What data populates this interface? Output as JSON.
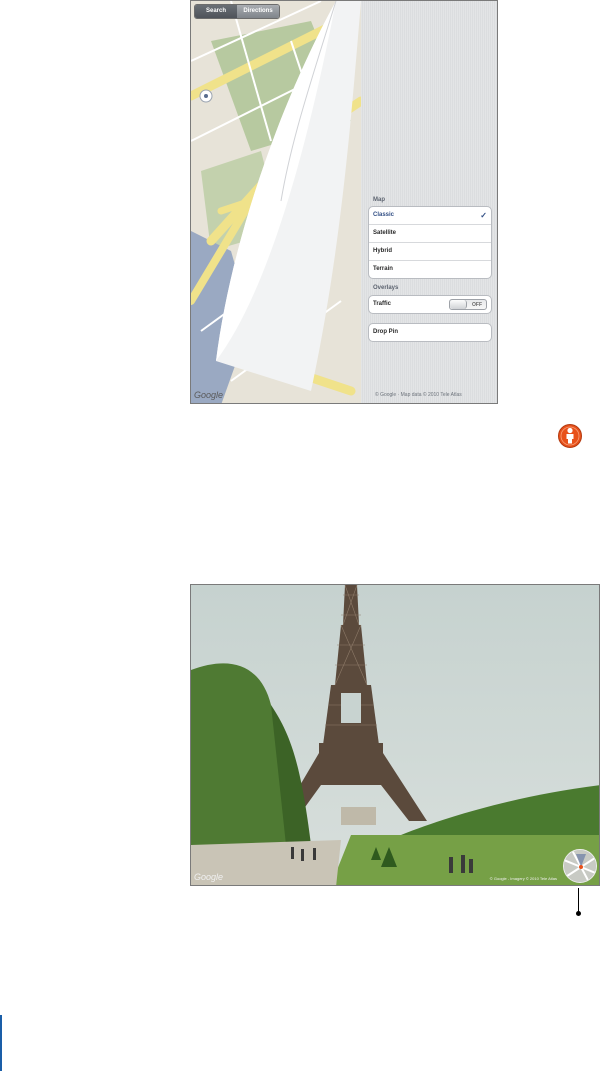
{
  "maps": {
    "segmented": [
      "Search",
      "Directions"
    ],
    "map_logo": "Google",
    "panel": {
      "map_section": "Map",
      "map_options": [
        {
          "label": "Classic",
          "selected": true
        },
        {
          "label": "Satellite",
          "selected": false
        },
        {
          "label": "Hybrid",
          "selected": false
        },
        {
          "label": "Terrain",
          "selected": false
        }
      ],
      "overlays_section": "Overlays",
      "traffic_label": "Traffic",
      "traffic_state": "OFF",
      "drop_pin_label": "Drop Pin",
      "footer": "© Google · Map data © 2010 Tele Atlas"
    }
  },
  "street_view": {
    "google_logo": "Google",
    "copyright": "© Google - Imagery © 2010 Tele Atlas"
  },
  "icons": {
    "pegman": "pegman-icon",
    "checkmark": "✓"
  },
  "colors": {
    "selected_text": "#324f85",
    "pegman_orange": "#e8511a",
    "margin_bar": "#1a5ea8"
  }
}
